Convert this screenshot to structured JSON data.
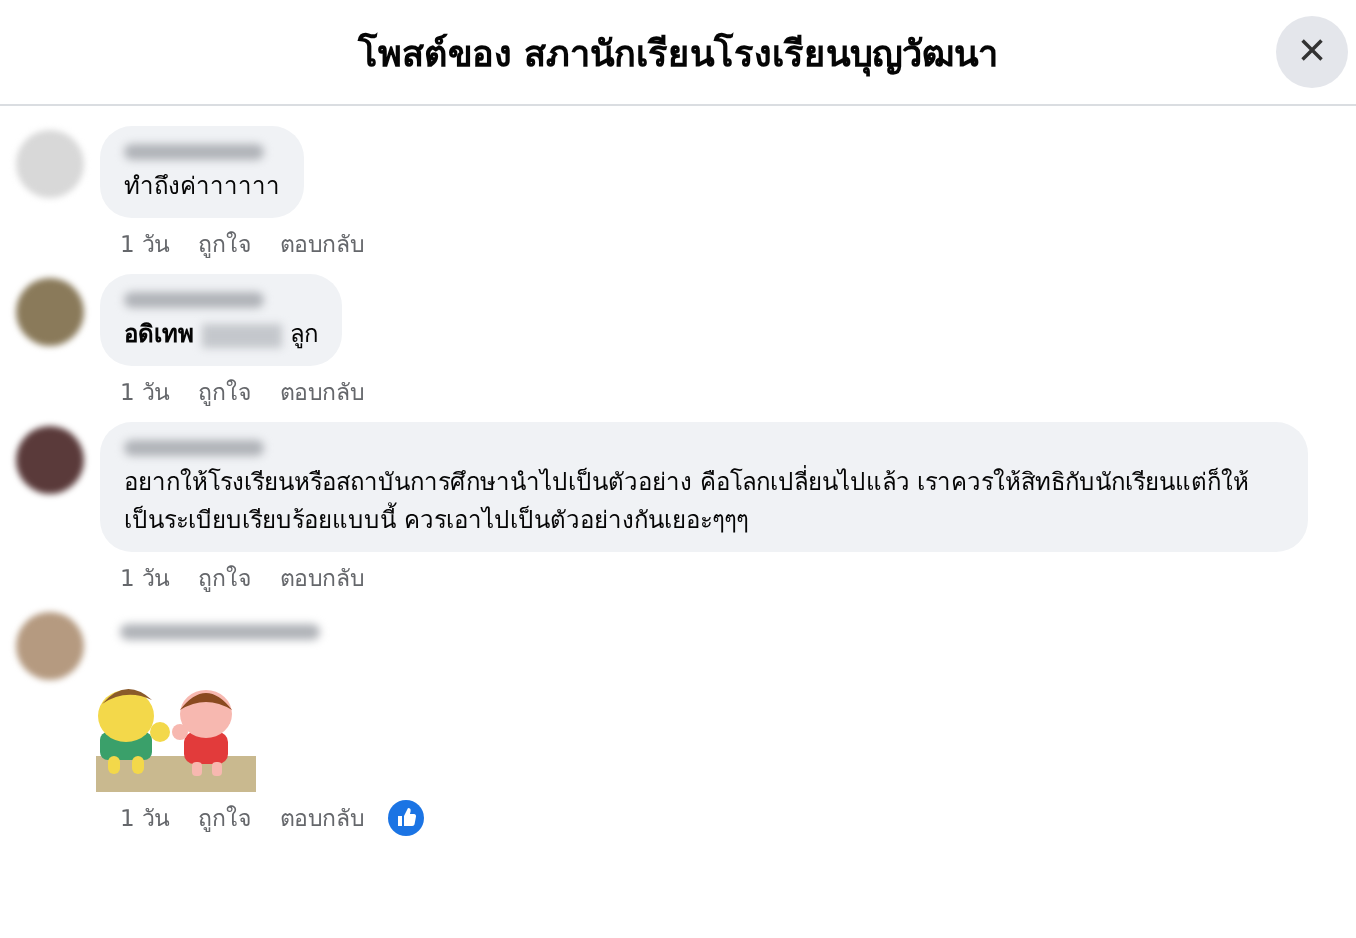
{
  "header": {
    "title": "โพสต์ของ สภานักเรียนโรงเรียนบุญวัฒนา",
    "close": "×"
  },
  "comments": [
    {
      "kind": "text",
      "body": "ทำถึงค่าาาาาา",
      "time": "1 วัน",
      "like": "ถูกใจ",
      "reply": "ตอบกลับ",
      "reacted": false
    },
    {
      "kind": "mention",
      "bold": "อดิเทพ",
      "after": "ลูก",
      "time": "1 วัน",
      "like": "ถูกใจ",
      "reply": "ตอบกลับ",
      "reacted": false
    },
    {
      "kind": "text",
      "body": "อยากให้โรงเรียนหรือสถาบันการศึกษานำไปเป็นตัวอย่าง คือโลกเปลี่ยนไปแล้ว เราควรให้สิทธิกับนักเรียนแต่ก็ให้เป็นระเบียบเรียบร้อยแบบนี้ ควรเอาไปเป็นตัวอย่างกันเยอะๆๆๆ",
      "time": "1 วัน",
      "like": "ถูกใจ",
      "reply": "ตอบกลับ",
      "reacted": false
    },
    {
      "kind": "sticker",
      "time": "1 วัน",
      "like": "ถูกใจ",
      "reply": "ตอบกลับ",
      "reacted": true
    }
  ]
}
